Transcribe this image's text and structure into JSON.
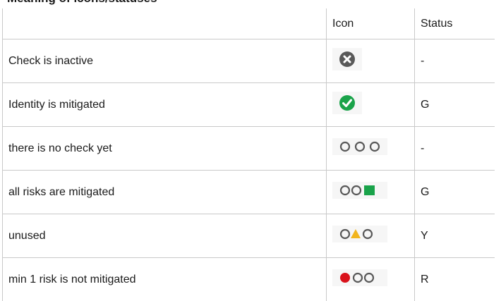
{
  "heading": "Meaning of icons/statuses",
  "table": {
    "headers": [
      "",
      "Icon",
      "Status"
    ],
    "rows": [
      {
        "description": "Check is inactive",
        "icon": "grey-x-circle-icon",
        "status": "-"
      },
      {
        "description": "Identity is mitigated",
        "icon": "green-check-circle-icon",
        "status": "G"
      },
      {
        "description": "there is no check yet",
        "icon": "three-empty-circles-icon",
        "status": "-"
      },
      {
        "description": "all risks are mitigated",
        "icon": "two-circles-green-square-icon",
        "status": "G"
      },
      {
        "description": "unused",
        "icon": "circle-yellow-triangle-circle-icon",
        "status": "Y"
      },
      {
        "description": "min 1 risk is not mitigated",
        "icon": "red-dot-two-circles-icon",
        "status": "R"
      }
    ]
  },
  "colors": {
    "grey": "#595959",
    "green": "#1aa34a",
    "yellow": "#f2b51d",
    "red": "#d9121b",
    "border": "#c9c9c9"
  }
}
